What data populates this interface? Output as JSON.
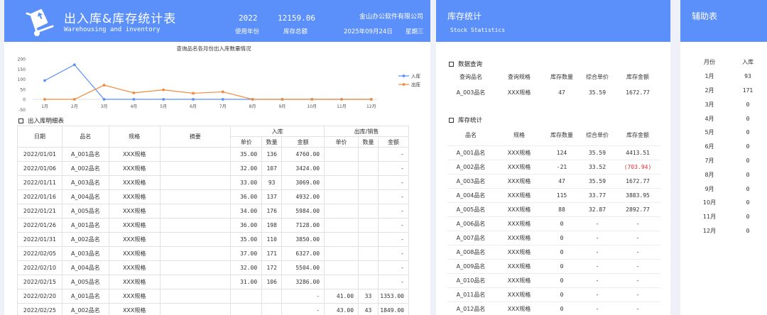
{
  "header": {
    "title": "出入库&库存统计表",
    "subtitle": "Warehousing and inventory",
    "year_value": "2022",
    "year_label": "使用年份",
    "total_value": "12159.06",
    "total_label": "库存总额",
    "company": "金山办公软件有限公司",
    "date": "2025年09月24日",
    "weekday": "星期三"
  },
  "chart_data": {
    "type": "line",
    "title": "查询品名各月份出入库数量情况",
    "categories": [
      "1月",
      "2月",
      "3月",
      "4月",
      "5月",
      "6月",
      "7月",
      "8月",
      "9月",
      "10月",
      "11月",
      "12月"
    ],
    "ylim": [
      0,
      200
    ],
    "yticks": [
      "200",
      "150",
      "100",
      "50",
      "0",
      "-50"
    ],
    "legend_position": "right",
    "series": [
      {
        "name": "入库",
        "color": "#5b8ff9",
        "values": [
          93,
          171,
          0,
          0,
          0,
          0,
          0,
          0,
          0,
          0,
          0,
          0
        ]
      },
      {
        "name": "出库",
        "color": "#f08a3c",
        "values": [
          0,
          0,
          70,
          32,
          47,
          30,
          37,
          0,
          0,
          0,
          0,
          0
        ]
      }
    ]
  },
  "detail": {
    "section_title": "出入库明细表",
    "headers": {
      "date": "日期",
      "name": "品名",
      "spec": "规格",
      "memo": "摘要",
      "in_group": "入库",
      "out_group": "出库/销售",
      "price": "单价",
      "qty": "数量",
      "amount": "金额"
    },
    "rows": [
      {
        "date": "2022/01/01",
        "name": "A_001品名",
        "spec": "XXX规格",
        "in_price": "35.00",
        "in_qty": "136",
        "in_amt": "4760.00",
        "out_price": "",
        "out_qty": "",
        "out_amt": "-"
      },
      {
        "date": "2022/01/06",
        "name": "A_002品名",
        "spec": "XXX规格",
        "in_price": "32.00",
        "in_qty": "107",
        "in_amt": "3424.00",
        "out_price": "",
        "out_qty": "",
        "out_amt": "-"
      },
      {
        "date": "2022/01/11",
        "name": "A_003品名",
        "spec": "XXX规格",
        "in_price": "33.00",
        "in_qty": "93",
        "in_amt": "3069.00",
        "out_price": "",
        "out_qty": "",
        "out_amt": "-"
      },
      {
        "date": "2022/01/16",
        "name": "A_004品名",
        "spec": "XXX规格",
        "in_price": "36.00",
        "in_qty": "137",
        "in_amt": "4932.00",
        "out_price": "",
        "out_qty": "",
        "out_amt": "-"
      },
      {
        "date": "2022/01/21",
        "name": "A_005品名",
        "spec": "XXX规格",
        "in_price": "34.00",
        "in_qty": "176",
        "in_amt": "5984.00",
        "out_price": "",
        "out_qty": "",
        "out_amt": "-"
      },
      {
        "date": "2022/01/26",
        "name": "A_001品名",
        "spec": "XXX规格",
        "in_price": "36.00",
        "in_qty": "198",
        "in_amt": "7128.00",
        "out_price": "",
        "out_qty": "",
        "out_amt": "-"
      },
      {
        "date": "2022/01/31",
        "name": "A_002品名",
        "spec": "XXX规格",
        "in_price": "35.00",
        "in_qty": "110",
        "in_amt": "3850.00",
        "out_price": "",
        "out_qty": "",
        "out_amt": "-"
      },
      {
        "date": "2022/02/05",
        "name": "A_003品名",
        "spec": "XXX规格",
        "in_price": "37.00",
        "in_qty": "171",
        "in_amt": "6327.00",
        "out_price": "",
        "out_qty": "",
        "out_amt": "-"
      },
      {
        "date": "2022/02/10",
        "name": "A_004品名",
        "spec": "XXX规格",
        "in_price": "32.00",
        "in_qty": "172",
        "in_amt": "5504.00",
        "out_price": "",
        "out_qty": "",
        "out_amt": "-"
      },
      {
        "date": "2022/02/15",
        "name": "A_005品名",
        "spec": "XXX规格",
        "in_price": "31.00",
        "in_qty": "106",
        "in_amt": "3286.00",
        "out_price": "",
        "out_qty": "",
        "out_amt": "-"
      },
      {
        "date": "2022/02/20",
        "name": "A_001品名",
        "spec": "XXX规格",
        "in_price": "",
        "in_qty": "",
        "in_amt": "-",
        "out_price": "41.00",
        "out_qty": "33",
        "out_amt": "1353.00"
      },
      {
        "date": "2022/02/25",
        "name": "A_002品名",
        "spec": "XXX规格",
        "in_price": "",
        "in_qty": "",
        "in_amt": "-",
        "out_price": "43.00",
        "out_qty": "43",
        "out_amt": "1849.00"
      }
    ]
  },
  "stock": {
    "title": "库存统计",
    "subtitle": "Stock Statistics",
    "query_section": "数据查询",
    "query_headers": [
      "查询品名",
      "查询规格",
      "库存数量",
      "综合单价",
      "库存金额"
    ],
    "query_row": [
      "A_003品名",
      "XXX规格",
      "47",
      "35.59",
      "1672.77"
    ],
    "stat_section": "库存统计",
    "stat_headers": [
      "品名",
      "规格",
      "库存数量",
      "综合单价",
      "库存金额"
    ],
    "stat_rows": [
      [
        "A_001品名",
        "XXX规格",
        "124",
        "35.59",
        "4413.51"
      ],
      [
        "A_002品名",
        "XXX规格",
        "-21",
        "33.52",
        "(703.94)"
      ],
      [
        "A_003品名",
        "XXX规格",
        "47",
        "35.59",
        "1672.77"
      ],
      [
        "A_004品名",
        "XXX规格",
        "115",
        "33.77",
        "3883.95"
      ],
      [
        "A_005品名",
        "XXX规格",
        "88",
        "32.87",
        "2892.77"
      ],
      [
        "A_006品名",
        "XXX规格",
        "0",
        "-",
        "-"
      ],
      [
        "A_007品名",
        "XXX规格",
        "0",
        "-",
        "-"
      ],
      [
        "A_008品名",
        "XXX规格",
        "0",
        "-",
        "-"
      ],
      [
        "A_009品名",
        "XXX规格",
        "0",
        "-",
        "-"
      ],
      [
        "A_010品名",
        "XXX规格",
        "0",
        "-",
        "-"
      ],
      [
        "A_011品名",
        "XXX规格",
        "0",
        "-",
        "-"
      ],
      [
        "A_012品名",
        "XXX规格",
        "0",
        "-",
        "-"
      ]
    ],
    "negative_color": "#e33333"
  },
  "aux": {
    "title": "辅助表",
    "headers": [
      "月份",
      "入库"
    ],
    "rows": [
      [
        "1月",
        "93"
      ],
      [
        "2月",
        "171"
      ],
      [
        "3月",
        "0"
      ],
      [
        "4月",
        "0"
      ],
      [
        "5月",
        "0"
      ],
      [
        "6月",
        "0"
      ],
      [
        "7月",
        "0"
      ],
      [
        "8月",
        "0"
      ],
      [
        "9月",
        "0"
      ],
      [
        "10月",
        "0"
      ],
      [
        "11月",
        "0"
      ],
      [
        "12月",
        "0"
      ]
    ]
  }
}
